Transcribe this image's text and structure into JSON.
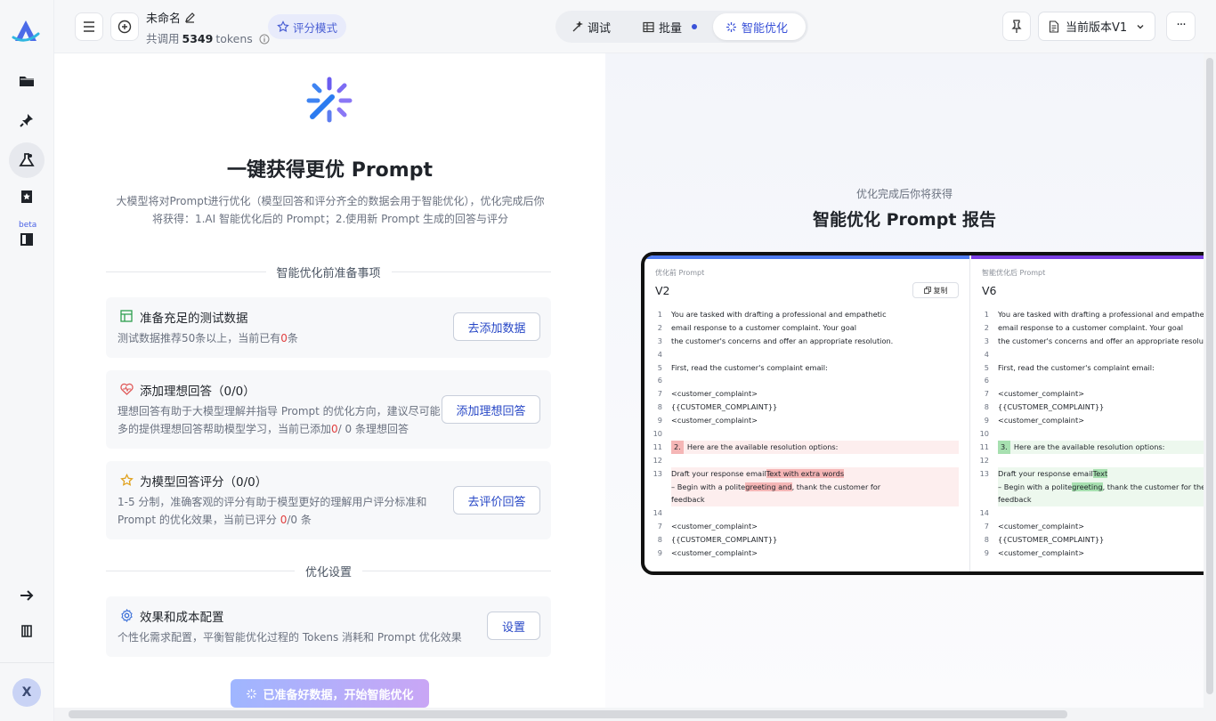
{
  "rail": {
    "beta_label": "beta",
    "avatar_initial": "X",
    "icons": [
      "folder-icon",
      "pin-icon",
      "flask-icon",
      "star-badge-icon",
      "dataset-icon",
      "arrow-right-icon",
      "book-icon"
    ]
  },
  "header": {
    "title": "未命名",
    "usage_prefix": "共调用",
    "usage_count": "5349",
    "usage_suffix": "tokens",
    "eval_mode_label": "评分模式",
    "tabs": [
      {
        "label": "调试",
        "active": false
      },
      {
        "label": "批量",
        "active": false,
        "dot": true
      },
      {
        "label": "智能优化",
        "active": true
      }
    ],
    "version_label": "当前版本V1",
    "more_label": "···"
  },
  "left": {
    "headline": "一键获得更优 Prompt",
    "description": "大模型将对Prompt进行优化（模型回答和评分齐全的数据会用于智能优化），优化完成后你将获得：1.AI 智能优化后的 Prompt；2.使用新 Prompt 生成的回答与评分",
    "section_prep": "智能优化前准备事项",
    "cards": [
      {
        "title": "准备充足的测试数据",
        "desc_a": "测试数据推荐50条以上，当前已有",
        "desc_red": "0",
        "desc_b": "条",
        "button": "去添加数据"
      },
      {
        "title": "添加理想回答（0/0）",
        "desc_line1": "理想回答有助于大模型理解并指导 Prompt 的优化方向，建议尽可能",
        "desc_a": "多的提供理想回答帮助模型学习，当前已添加",
        "desc_red": "0",
        "desc_b": "/ 0 条理想回答",
        "button": "添加理想回答"
      },
      {
        "title": "为模型回答评分（0/0）",
        "desc_line1": "1-5 分制，准确客观的评分有助于模型更好的理解用户评分标准和",
        "desc_a": "Prompt 的优化效果，当前已评分 ",
        "desc_red": "0",
        "desc_b": "/0 条",
        "button": "去评价回答"
      }
    ],
    "section_settings": "优化设置",
    "settings_card": {
      "title": "效果和成本配置",
      "desc": "个性化需求配置，平衡智能优化过程的 Tokens 消耗和 Prompt 优化效果",
      "button": "设置"
    },
    "cta": "已准备好数据，开始智能优化"
  },
  "right": {
    "subtitle": "优化完成后你将获得",
    "title": "智能优化 Prompt 报告",
    "before": {
      "label": "优化前 Prompt",
      "version": "V2",
      "copy_label": "复制",
      "bar_color": "#4f7bf0",
      "lines": [
        {
          "n": "1",
          "t": "You are tasked with drafting a professional and empathetic"
        },
        {
          "n": "2",
          "t": "email response to a customer complaint. Your goal"
        },
        {
          "n": "3",
          "t": "the customer's concerns and offer an appropriate resolution."
        },
        {
          "n": "4",
          "t": ""
        },
        {
          "n": "5",
          "t": "First, read the customer's complaint email:"
        },
        {
          "n": "6",
          "t": ""
        },
        {
          "n": "7",
          "t": "<customer_complaint>"
        },
        {
          "n": "8",
          "t": "{{CUSTOMER_COMPLAINT}}"
        },
        {
          "n": "9",
          "t": "<customer_complaint>"
        },
        {
          "n": "10",
          "t": ""
        },
        {
          "n": "11",
          "num": "2.",
          "t": "Here are the available resolution options:",
          "type": "del"
        },
        {
          "n": "12",
          "t": ""
        },
        {
          "n": "13",
          "t": "Draft your response email",
          "hl": "Text with extra words",
          "type": "del2"
        },
        {
          "n": "",
          "t": "– Begin with a polite",
          "hl": "greeting and",
          "tail": ", thank the customer for",
          "type": "del2"
        },
        {
          "n": "",
          "t": "feedback",
          "type": "del2"
        },
        {
          "n": "14",
          "t": ""
        },
        {
          "n": "7",
          "t": "<customer_complaint>"
        },
        {
          "n": "8",
          "t": "{{CUSTOMER_COMPLAINT}}"
        },
        {
          "n": "9",
          "t": "<customer_complaint>"
        }
      ]
    },
    "after": {
      "label": "智能优化后 Prompt",
      "version": "V6",
      "bar_color": "#7b3fe4",
      "lines": [
        {
          "n": "1",
          "t": "You are tasked with drafting a professional and empathetic"
        },
        {
          "n": "2",
          "t": "email response to a customer complaint. Your goal"
        },
        {
          "n": "3",
          "t": "the customer's concerns and offer an appropriate resolution."
        },
        {
          "n": "4",
          "t": ""
        },
        {
          "n": "5",
          "t": "First, read the customer's complaint email:"
        },
        {
          "n": "6",
          "t": ""
        },
        {
          "n": "7",
          "t": "<customer_complaint>"
        },
        {
          "n": "8",
          "t": "{{CUSTOMER_COMPLAINT}}"
        },
        {
          "n": "9",
          "t": "<customer_complaint>"
        },
        {
          "n": "10",
          "t": ""
        },
        {
          "n": "11",
          "num": "3.",
          "t": "Here are the available resolution options:",
          "type": "add"
        },
        {
          "n": "12",
          "t": ""
        },
        {
          "n": "13",
          "t": "Draft your response email",
          "hl": "Text",
          "type": "add2"
        },
        {
          "n": "",
          "t": "– Begin with a polite",
          "hl": "greeting",
          "tail": ", thank the customer for their",
          "type": "add2"
        },
        {
          "n": "",
          "t": "feedback",
          "type": "add2"
        },
        {
          "n": "14",
          "t": ""
        },
        {
          "n": "7",
          "t": "<customer_complaint>"
        },
        {
          "n": "8",
          "t": "{{CUSTOMER_COMPLAINT}}"
        },
        {
          "n": "9",
          "t": "<customer_complaint>"
        }
      ]
    }
  }
}
